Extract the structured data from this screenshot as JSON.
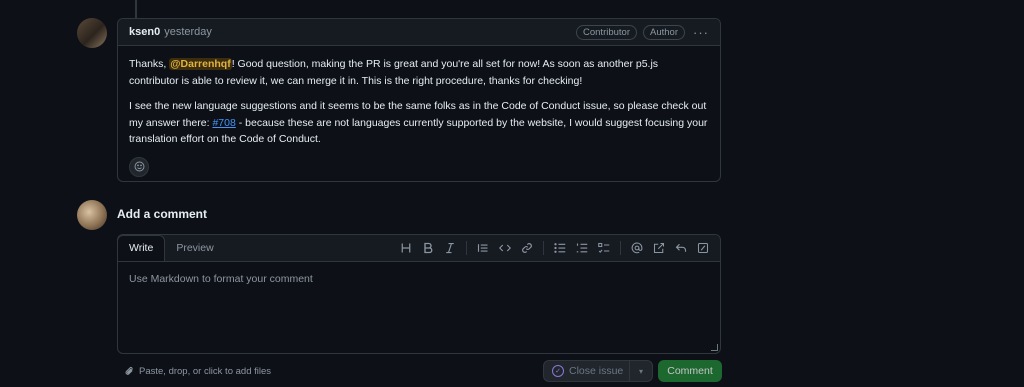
{
  "comment": {
    "author": "ksen0",
    "time": "yesterday",
    "badges": [
      "Contributor",
      "Author"
    ],
    "p1": {
      "before": "Thanks, ",
      "mention": "@Darrenhqf",
      "after": "! Good question, making the PR is great and you're all set for now! As soon as another p5.js contributor is able to review it, we can merge it in. This is the right procedure, thanks for checking!"
    },
    "p2": {
      "before": "I see the new language suggestions and it seems to be the same folks as in the Code of Conduct issue, so please check out my answer there: ",
      "link": "#708",
      "after": " - because these are not languages currently supported by the website, I would suggest focusing your translation effort on the Code of Conduct."
    }
  },
  "add_comment": {
    "title": "Add a comment",
    "tabs": {
      "write": "Write",
      "preview": "Preview"
    },
    "placeholder": "Use Markdown to format your comment",
    "toolbar_icons": [
      "heading-icon",
      "bold-icon",
      "italic-icon",
      "quote-icon",
      "code-icon",
      "link-icon",
      "unordered-list-icon",
      "ordered-list-icon",
      "task-list-icon",
      "mention-icon",
      "cross-reference-icon",
      "reply-icon",
      "slash-commands-icon"
    ],
    "attach_label": "Paste, drop, or click to add files",
    "close_issue_label": "Close issue",
    "comment_label": "Comment"
  },
  "colors": {
    "accent_green": "#238636",
    "mention": "#e3b341",
    "link": "#4493f8",
    "closed_purple": "#8a78d6"
  }
}
